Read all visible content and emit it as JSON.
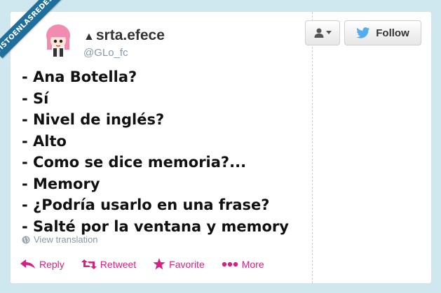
{
  "watermark": "VISTOENLASREDES.COM",
  "profile": {
    "display_name": "srta.efece",
    "name_prefix_icon": "triangle-up-icon",
    "handle": "@GLo_fc"
  },
  "buttons": {
    "user_menu_icon": "person-icon",
    "follow_label": "Follow",
    "follow_icon": "twitter-bird-icon"
  },
  "tweet": {
    "lines": [
      "- Ana Botella?",
      "- Sí",
      "- Nivel de inglés?",
      "- Alto",
      "- Como se dice memoria?...",
      "- Memory",
      "- ¿Podría usarlo en una frase?",
      "- Salté por la ventana y memory"
    ],
    "translation_label": "View translation"
  },
  "actions": [
    {
      "label": "Reply",
      "icon": "reply-arrow-icon"
    },
    {
      "label": "Retweet",
      "icon": "retweet-icon"
    },
    {
      "label": "Favorite",
      "icon": "star-icon"
    },
    {
      "label": "More",
      "icon": "more-dots-icon"
    }
  ],
  "colors": {
    "accent": "#d81f83",
    "twitter_blue": "#55acee",
    "ribbon": "#1f6f9c"
  }
}
